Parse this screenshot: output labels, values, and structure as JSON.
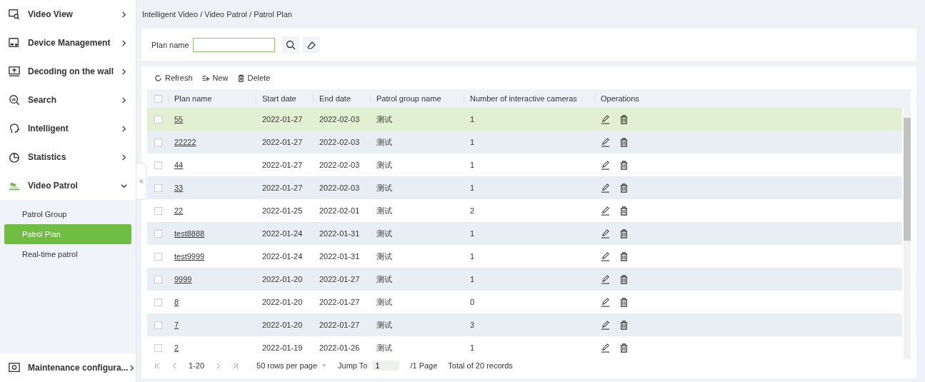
{
  "sidebar": {
    "items": [
      {
        "label": "Video View",
        "expanded": false
      },
      {
        "label": "Device Management",
        "expanded": false
      },
      {
        "label": "Decoding on the wall",
        "expanded": false
      },
      {
        "label": "Search",
        "expanded": false
      },
      {
        "label": "Intelligent",
        "expanded": false
      },
      {
        "label": "Statistics",
        "expanded": false
      },
      {
        "label": "Video Patrol",
        "expanded": true,
        "children": [
          {
            "label": "Patrol Group",
            "selected": false
          },
          {
            "label": "Patrol Plan",
            "selected": true
          },
          {
            "label": "Real-time patrol",
            "selected": false
          }
        ]
      }
    ],
    "footer_item": {
      "label": "Maintenance configura...",
      "expanded": false
    }
  },
  "breadcrumb": "Intelligent Video / Video Patrol / Patrol Plan",
  "search": {
    "label": "Plan name"
  },
  "toolbar": [
    "Refresh",
    "New",
    "Delete"
  ],
  "table": {
    "all_checked": false,
    "columns": [
      "Plan name",
      "Start date",
      "End date",
      "Patrol group name",
      "Number of interactive cameras",
      "Operations"
    ],
    "rows": [
      {
        "selected": true,
        "checked": false,
        "cells": [
          "55",
          "2022-01-27",
          "2022-02-03",
          "测试",
          "1"
        ]
      },
      {
        "selected": false,
        "checked": false,
        "cells": [
          "22222",
          "2022-01-27",
          "2022-02-03",
          "测试",
          "1"
        ]
      },
      {
        "selected": false,
        "checked": false,
        "cells": [
          "44",
          "2022-01-27",
          "2022-02-03",
          "测试",
          "1"
        ]
      },
      {
        "selected": false,
        "checked": false,
        "cells": [
          "33",
          "2022-01-27",
          "2022-02-03",
          "测试",
          "1"
        ]
      },
      {
        "selected": false,
        "checked": false,
        "cells": [
          "22",
          "2022-01-25",
          "2022-02-01",
          "测试",
          "2"
        ]
      },
      {
        "selected": false,
        "checked": false,
        "cells": [
          "test8888",
          "2022-01-24",
          "2022-01-31",
          "测试",
          "1"
        ]
      },
      {
        "selected": false,
        "checked": false,
        "cells": [
          "test9999",
          "2022-01-24",
          "2022-01-31",
          "测试",
          "1"
        ]
      },
      {
        "selected": false,
        "checked": false,
        "cells": [
          "9999",
          "2022-01-20",
          "2022-01-27",
          "测试",
          "1"
        ]
      },
      {
        "selected": false,
        "checked": false,
        "cells": [
          "8",
          "2022-01-20",
          "2022-01-27",
          "测试",
          "0"
        ]
      },
      {
        "selected": false,
        "checked": false,
        "cells": [
          "7",
          "2022-01-20",
          "2022-01-27",
          "测试",
          "3"
        ]
      },
      {
        "selected": false,
        "checked": false,
        "cells": [
          "2",
          "2022-01-19",
          "2022-01-26",
          "测试",
          "1"
        ]
      }
    ]
  },
  "pagination": {
    "range": "1-20",
    "rows_per_page": "50 rows per page",
    "jump_label": "Jump To",
    "page_value": "1",
    "pages": "/1 Page",
    "total": "Total of 20 records"
  }
}
